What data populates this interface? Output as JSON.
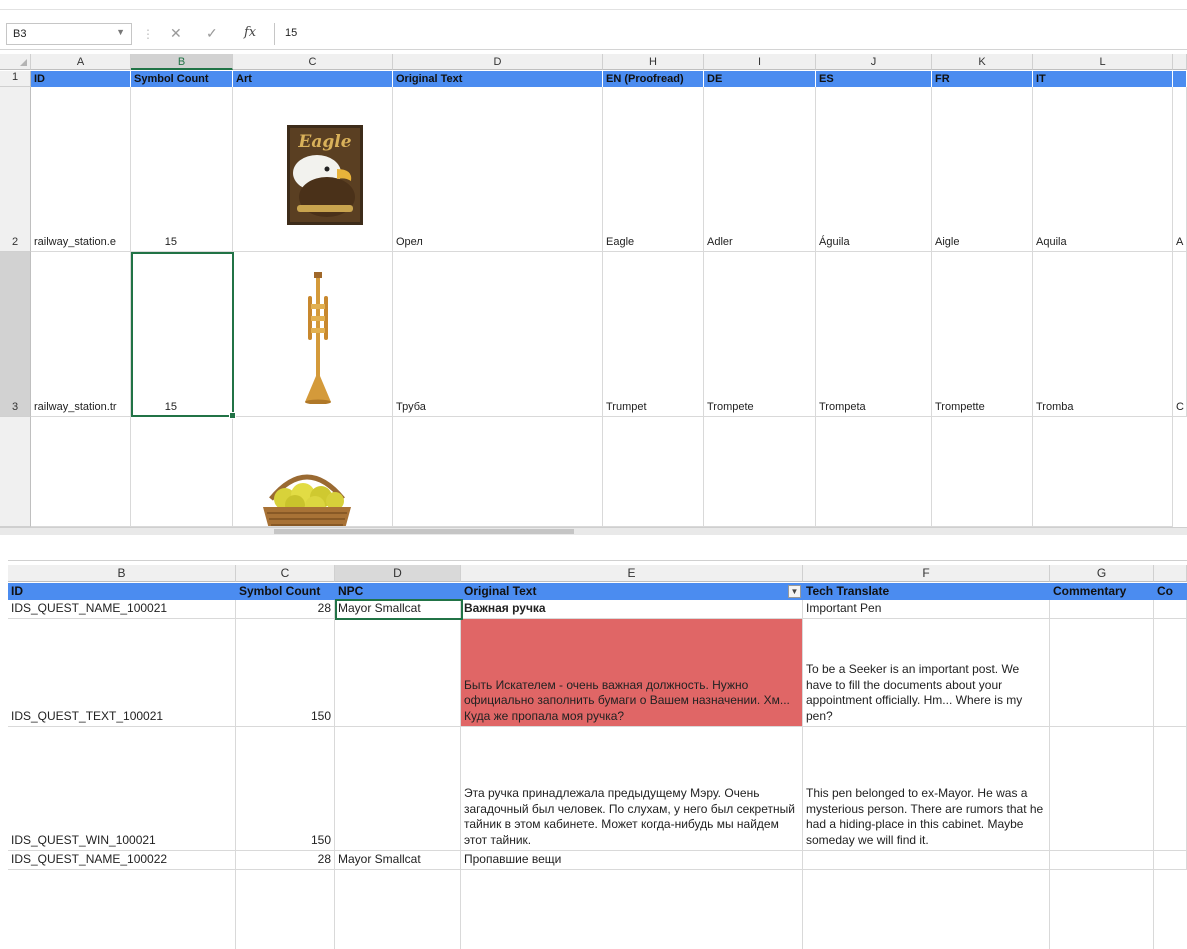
{
  "sheet1": {
    "name_box": "B3",
    "formula_value": "15",
    "columns": [
      "A",
      "B",
      "C",
      "D",
      "H",
      "I",
      "J",
      "K",
      "L"
    ],
    "row_numbers": [
      "1",
      "2",
      "3"
    ],
    "headers": [
      "ID",
      "Symbol Count",
      "Art",
      "Original Text",
      "EN (Proofread)",
      "DE",
      "ES",
      "FR",
      "IT"
    ],
    "rows": [
      {
        "id": "railway_station.e",
        "symbol_count": "15",
        "art": "eagle-image",
        "original": "Орел",
        "en": "Eagle",
        "de": "Adler",
        "es": "Águila",
        "fr": "Aigle",
        "it": "Aquila",
        "extra": "A"
      },
      {
        "id": "railway_station.tr",
        "symbol_count": "15",
        "art": "trumpet-image",
        "original": "Труба",
        "en": "Trumpet",
        "de": "Trompete",
        "es": "Trompeta",
        "fr": "Trompette",
        "it": "Tromba",
        "extra": "C"
      }
    ],
    "eagle_logo_text": "Eagle"
  },
  "sheet2": {
    "columns": [
      "B",
      "C",
      "D",
      "E",
      "F",
      "G"
    ],
    "headers": [
      "ID",
      "Symbol Count",
      "NPC",
      "Original Text",
      "Tech Translate",
      "Commentary",
      "Co"
    ],
    "rows": [
      {
        "id": "IDS_QUEST_NAME_100021",
        "count": "28",
        "npc": "Mayor Smallcat",
        "original": "Важная ручка",
        "translate": "Important Pen"
      },
      {
        "id": "IDS_QUEST_TEXT_100021",
        "count": "150",
        "npc": "",
        "original": "Быть Искателем - очень важная должность. Нужно официально заполнить бумаги о Вашем назначении. Хм... Куда же пропала моя ручка?",
        "translate": "To be a Seeker is an important post. We have to fill the documents about your appointment officially. Hm... Where is my pen?"
      },
      {
        "id": "IDS_QUEST_WIN_100021",
        "count": "150",
        "npc": "",
        "original": "Эта ручка принадлежала предыдущему Мэру. Очень загадочный был человек. По слухам, у него был секретный тайник в этом кабинете. Может когда-нибудь мы найдем этот тайник.",
        "translate": "This pen belonged to ex-Mayor. He was a mysterious person. There are rumors that he had a hiding-place in this cabinet. Maybe someday we will find it."
      },
      {
        "id": "IDS_QUEST_NAME_100022",
        "count": "28",
        "npc": "Mayor Smallcat",
        "original": "Пропавшие вещи",
        "translate": ""
      }
    ]
  },
  "colors": {
    "header_blue": "#4b8cf0",
    "highlight_red": "#e06666",
    "excel_green": "#217346"
  }
}
